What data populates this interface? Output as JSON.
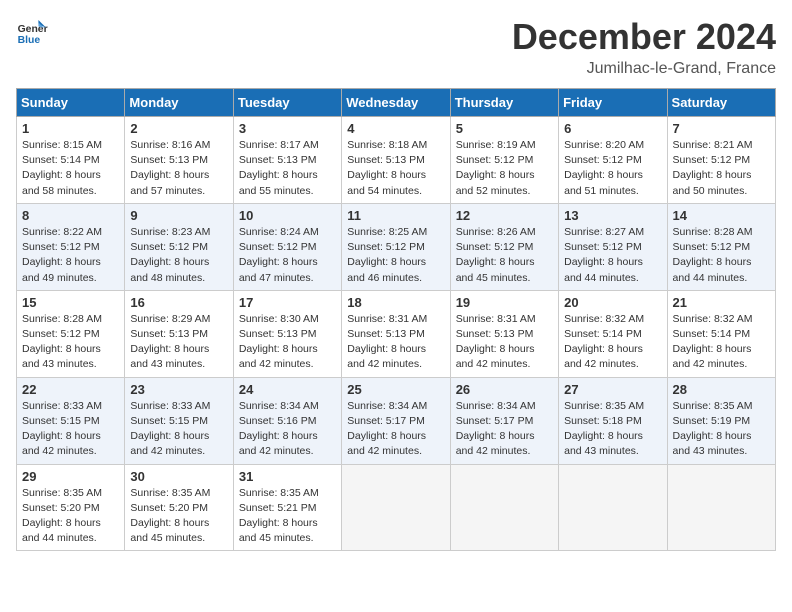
{
  "header": {
    "title": "December 2024",
    "location": "Jumilhac-le-Grand, France",
    "logo_general": "General",
    "logo_blue": "Blue"
  },
  "weekdays": [
    "Sunday",
    "Monday",
    "Tuesday",
    "Wednesday",
    "Thursday",
    "Friday",
    "Saturday"
  ],
  "weeks": [
    [
      {
        "day": 1,
        "sunrise": "8:15 AM",
        "sunset": "5:14 PM",
        "daylight": "8 hours and 58 minutes."
      },
      {
        "day": 2,
        "sunrise": "8:16 AM",
        "sunset": "5:13 PM",
        "daylight": "8 hours and 57 minutes."
      },
      {
        "day": 3,
        "sunrise": "8:17 AM",
        "sunset": "5:13 PM",
        "daylight": "8 hours and 55 minutes."
      },
      {
        "day": 4,
        "sunrise": "8:18 AM",
        "sunset": "5:13 PM",
        "daylight": "8 hours and 54 minutes."
      },
      {
        "day": 5,
        "sunrise": "8:19 AM",
        "sunset": "5:12 PM",
        "daylight": "8 hours and 52 minutes."
      },
      {
        "day": 6,
        "sunrise": "8:20 AM",
        "sunset": "5:12 PM",
        "daylight": "8 hours and 51 minutes."
      },
      {
        "day": 7,
        "sunrise": "8:21 AM",
        "sunset": "5:12 PM",
        "daylight": "8 hours and 50 minutes."
      }
    ],
    [
      {
        "day": 8,
        "sunrise": "8:22 AM",
        "sunset": "5:12 PM",
        "daylight": "8 hours and 49 minutes."
      },
      {
        "day": 9,
        "sunrise": "8:23 AM",
        "sunset": "5:12 PM",
        "daylight": "8 hours and 48 minutes."
      },
      {
        "day": 10,
        "sunrise": "8:24 AM",
        "sunset": "5:12 PM",
        "daylight": "8 hours and 47 minutes."
      },
      {
        "day": 11,
        "sunrise": "8:25 AM",
        "sunset": "5:12 PM",
        "daylight": "8 hours and 46 minutes."
      },
      {
        "day": 12,
        "sunrise": "8:26 AM",
        "sunset": "5:12 PM",
        "daylight": "8 hours and 45 minutes."
      },
      {
        "day": 13,
        "sunrise": "8:27 AM",
        "sunset": "5:12 PM",
        "daylight": "8 hours and 44 minutes."
      },
      {
        "day": 14,
        "sunrise": "8:28 AM",
        "sunset": "5:12 PM",
        "daylight": "8 hours and 44 minutes."
      }
    ],
    [
      {
        "day": 15,
        "sunrise": "8:28 AM",
        "sunset": "5:12 PM",
        "daylight": "8 hours and 43 minutes."
      },
      {
        "day": 16,
        "sunrise": "8:29 AM",
        "sunset": "5:13 PM",
        "daylight": "8 hours and 43 minutes."
      },
      {
        "day": 17,
        "sunrise": "8:30 AM",
        "sunset": "5:13 PM",
        "daylight": "8 hours and 42 minutes."
      },
      {
        "day": 18,
        "sunrise": "8:31 AM",
        "sunset": "5:13 PM",
        "daylight": "8 hours and 42 minutes."
      },
      {
        "day": 19,
        "sunrise": "8:31 AM",
        "sunset": "5:13 PM",
        "daylight": "8 hours and 42 minutes."
      },
      {
        "day": 20,
        "sunrise": "8:32 AM",
        "sunset": "5:14 PM",
        "daylight": "8 hours and 42 minutes."
      },
      {
        "day": 21,
        "sunrise": "8:32 AM",
        "sunset": "5:14 PM",
        "daylight": "8 hours and 42 minutes."
      }
    ],
    [
      {
        "day": 22,
        "sunrise": "8:33 AM",
        "sunset": "5:15 PM",
        "daylight": "8 hours and 42 minutes."
      },
      {
        "day": 23,
        "sunrise": "8:33 AM",
        "sunset": "5:15 PM",
        "daylight": "8 hours and 42 minutes."
      },
      {
        "day": 24,
        "sunrise": "8:34 AM",
        "sunset": "5:16 PM",
        "daylight": "8 hours and 42 minutes."
      },
      {
        "day": 25,
        "sunrise": "8:34 AM",
        "sunset": "5:17 PM",
        "daylight": "8 hours and 42 minutes."
      },
      {
        "day": 26,
        "sunrise": "8:34 AM",
        "sunset": "5:17 PM",
        "daylight": "8 hours and 42 minutes."
      },
      {
        "day": 27,
        "sunrise": "8:35 AM",
        "sunset": "5:18 PM",
        "daylight": "8 hours and 43 minutes."
      },
      {
        "day": 28,
        "sunrise": "8:35 AM",
        "sunset": "5:19 PM",
        "daylight": "8 hours and 43 minutes."
      }
    ],
    [
      {
        "day": 29,
        "sunrise": "8:35 AM",
        "sunset": "5:20 PM",
        "daylight": "8 hours and 44 minutes."
      },
      {
        "day": 30,
        "sunrise": "8:35 AM",
        "sunset": "5:20 PM",
        "daylight": "8 hours and 45 minutes."
      },
      {
        "day": 31,
        "sunrise": "8:35 AM",
        "sunset": "5:21 PM",
        "daylight": "8 hours and 45 minutes."
      },
      null,
      null,
      null,
      null
    ]
  ]
}
